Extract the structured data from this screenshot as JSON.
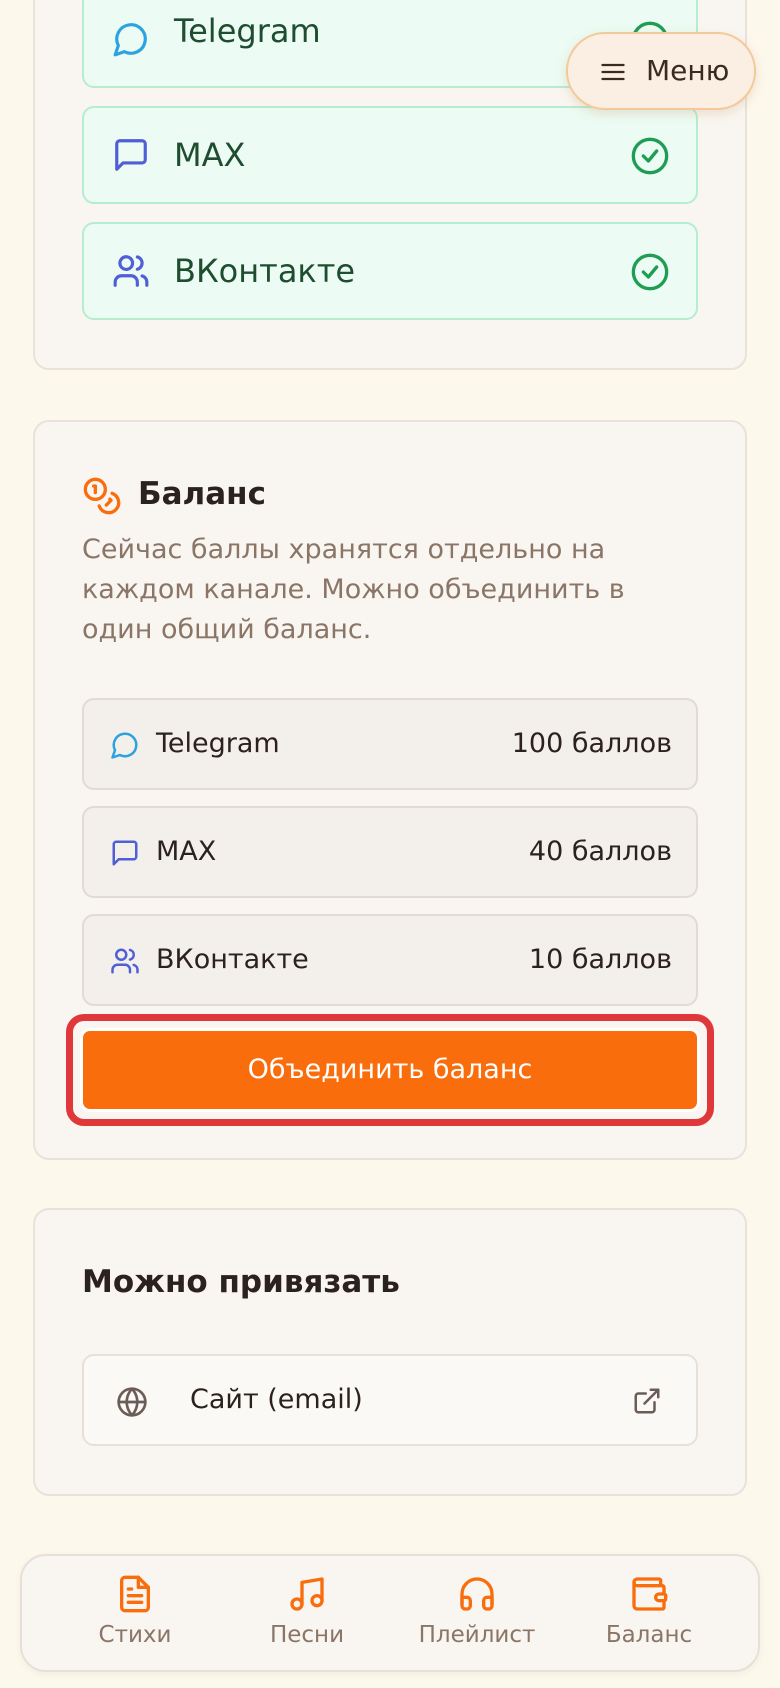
{
  "menu": {
    "label": "Меню"
  },
  "connected": {
    "items": [
      {
        "label": "Telegram",
        "icon": "chat-bubble-icon",
        "status": "check-circle-icon"
      },
      {
        "label": "MAX",
        "icon": "message-square-icon",
        "status": "check-circle-icon"
      },
      {
        "label": "ВКонтакте",
        "icon": "users-icon",
        "status": "check-circle-icon"
      }
    ]
  },
  "balance": {
    "title": "Баланс",
    "icon": "coins-icon",
    "description": "Сейчас баллы хранятся отдельно на каждом канале. Можно объединить в один общий баланс.",
    "rows": [
      {
        "label": "Telegram",
        "value": "100 баллов",
        "icon": "chat-bubble-icon"
      },
      {
        "label": "MAX",
        "value": "40 баллов",
        "icon": "message-square-icon"
      },
      {
        "label": "ВКонтакте",
        "value": "10 баллов",
        "icon": "users-icon"
      }
    ],
    "merge_label": "Объединить баланс"
  },
  "linkable": {
    "title": "Можно привязать",
    "items": [
      {
        "label": "Сайт (email)",
        "icon": "globe-icon",
        "action_icon": "external-link-icon"
      }
    ]
  },
  "bottom_nav": {
    "items": [
      {
        "label": "Стихи",
        "icon": "document-icon"
      },
      {
        "label": "Песни",
        "icon": "music-note-icon"
      },
      {
        "label": "Плейлист",
        "icon": "headphones-icon"
      },
      {
        "label": "Баланс",
        "icon": "wallet-icon"
      }
    ]
  },
  "colors": {
    "accent": "#f96d0c",
    "success": "#1f9d55",
    "telegram": "#2aa3e0",
    "max": "#4f5fd6",
    "highlight": "#e0373b"
  }
}
